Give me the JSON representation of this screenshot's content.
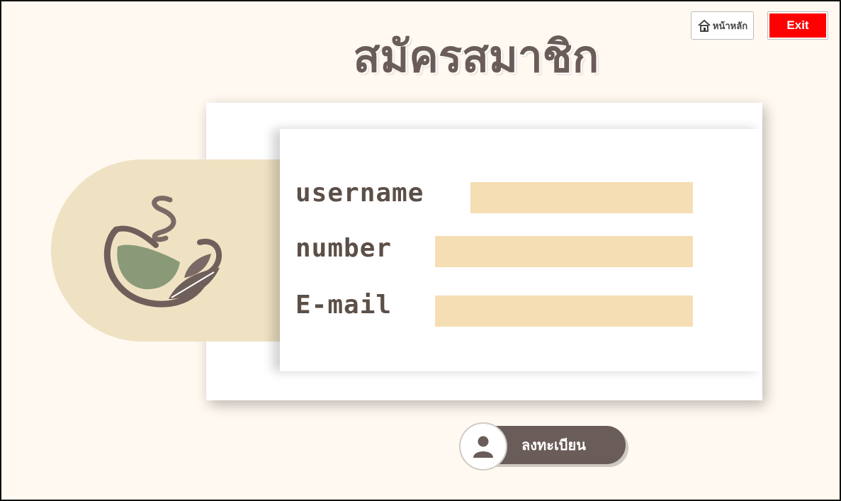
{
  "header": {
    "title": "สมัครสมาชิก",
    "home_label": "หน้าหลัก",
    "exit_label": "Exit"
  },
  "form": {
    "username_label": "username",
    "number_label": "number",
    "email_label": "E-mail",
    "username_value": "",
    "number_value": "",
    "email_value": ""
  },
  "actions": {
    "register_label": "ลงทะเบียน"
  },
  "colors": {
    "background": "#fff9f1",
    "accent_brown": "#6a5c58",
    "field_fill": "#f5deb3",
    "pill": "#efe2c3",
    "exit_red": "#ff0000",
    "cup_green": "#8a9a78"
  },
  "icons": [
    "home-icon",
    "coffee-cup-logo-icon",
    "user-icon"
  ]
}
